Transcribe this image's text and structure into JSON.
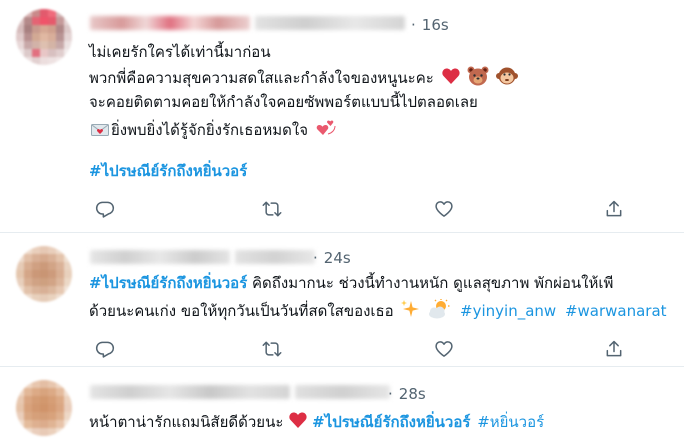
{
  "tweets": [
    {
      "time": "16s",
      "lines": [
        "ไม่เคยรักใครได้เท่านี้มาก่อน",
        "พวกพี่คือความสุขความสดใสและกำลังใจของหนูนะคะ",
        "จะคอยติดตามคอยให้กำลังใจคอยซัพพอร์ตแบบนี้ไปตลอดเลย",
        "ยิ่งพบยิ่งได้รู้จักยิ่งรักเธอหมดใจ"
      ],
      "hashtag": "#ไปรษณีย์รักถึงหยิ่นวอร์",
      "line_emojis": [
        "red-heart",
        "bear-face",
        "monkey-face",
        "love-letter",
        "revolving-hearts"
      ]
    },
    {
      "time": "24s",
      "hashtag_lead": "#ไปรษณีย์รักถึงหยิ่นวอร์",
      "line1_text": " คิดถึงมากนะ ช่วงนี้ทำงานหนัก ดูแลสุขภาพ พักผ่อนให้เพี",
      "line2_text": "ด้วยนะคนเก่ง ขอให้ทุกวันเป็นวันที่สดใสของเธอ ",
      "tag2": "#yinyin_anw",
      "tag3": "#warwanarat",
      "line_emojis": [
        "sparkles",
        "sun-behind-cloud"
      ]
    },
    {
      "time": "28s",
      "text": "หน้าตาน่ารักแถมนิสัยดีด้วยนะ ",
      "hashtag_bold": "#ไปรษณีย์รักถึงหยิ่นวอร์",
      "hashtag_plain": "#หยิ่นวอร์",
      "line_emojis": [
        "red-heart"
      ]
    }
  ],
  "actions": {
    "reply": "reply-icon",
    "retweet": "retweet-icon",
    "like": "heart-icon",
    "share": "share-icon"
  },
  "colors": {
    "link": "#1b95e0",
    "muted": "#536471",
    "divider": "#e6ecf0",
    "heart": "#e0245e"
  }
}
